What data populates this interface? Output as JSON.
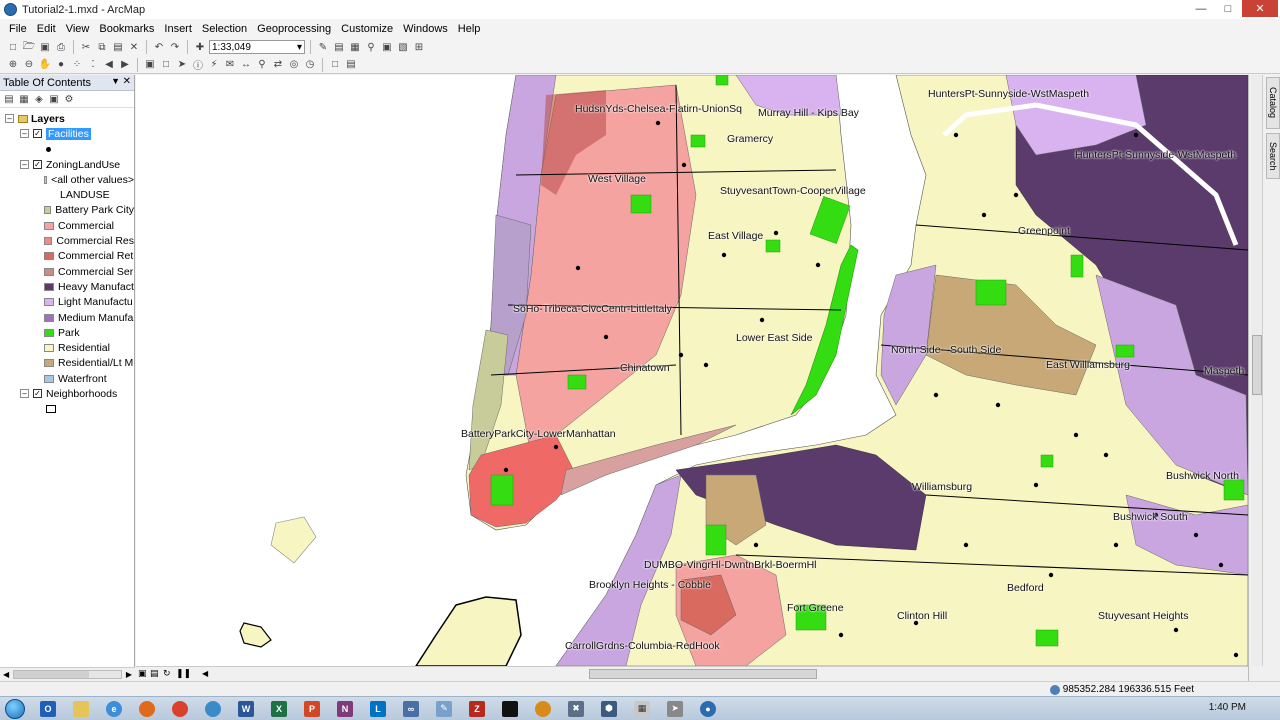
{
  "window": {
    "title": "Tutorial2-1.mxd - ArcMap"
  },
  "menu": [
    "File",
    "Edit",
    "View",
    "Bookmarks",
    "Insert",
    "Selection",
    "Geoprocessing",
    "Customize",
    "Windows",
    "Help"
  ],
  "toolbar": {
    "scale": "1:33,049"
  },
  "toc": {
    "title": "Table Of Contents",
    "root": "Layers",
    "facilities": "Facilities",
    "zoning": "ZoningLandUse",
    "all_other": "<all other values>",
    "landuse_header": "LANDUSE",
    "landuse_classes": [
      {
        "label": "Battery Park City",
        "color": "#c8cc9a"
      },
      {
        "label": "Commercial",
        "color": "#f4a3a0"
      },
      {
        "label": "Commercial Res",
        "color": "#f08b84"
      },
      {
        "label": "Commercial Ret",
        "color": "#d96a60"
      },
      {
        "label": "Commercial Ser",
        "color": "#c98c86"
      },
      {
        "label": "Heavy Manufact",
        "color": "#5a3b6b"
      },
      {
        "label": "Light Manufactu",
        "color": "#d9b3f0"
      },
      {
        "label": "Medium Manufa",
        "color": "#9e74b8"
      },
      {
        "label": "Park",
        "color": "#33dd11"
      },
      {
        "label": "Residential",
        "color": "#f7f5c1"
      },
      {
        "label": "Residential/Lt M",
        "color": "#c9a878"
      },
      {
        "label": "Waterfront",
        "color": "#a9c6e8"
      }
    ],
    "all_other_color": "#e6b3e6",
    "neighborhoods": "Neighborhoods"
  },
  "map": {
    "labels": [
      {
        "id": "hudson",
        "text": "HudsnYds-Chelsea-Flatirn-UnionSq"
      },
      {
        "id": "murray",
        "text": "Murray Hill - Kips Bay"
      },
      {
        "id": "gramercy",
        "text": "Gramercy"
      },
      {
        "id": "westvillage",
        "text": "West Village"
      },
      {
        "id": "stuy",
        "text": "StuyvesantTown-CooperVillage"
      },
      {
        "id": "eastvillage",
        "text": "East Village"
      },
      {
        "id": "soho",
        "text": "SoHo-Tribeca-CivcCentr-LittleItaly"
      },
      {
        "id": "les",
        "text": "Lower East Side"
      },
      {
        "id": "chinatown",
        "text": "Chinatown"
      },
      {
        "id": "bpc",
        "text": "BatteryParkCity-LowerManhattan"
      },
      {
        "id": "huntersTop",
        "text": "HuntersPt-Sunnyside-WstMaspeth"
      },
      {
        "id": "huntersMid",
        "text": "HuntersPt-Sunnyside-WstMaspeth"
      },
      {
        "id": "greenpoint",
        "text": "Greenpoint"
      },
      {
        "id": "northside",
        "text": "North Side - South Side"
      },
      {
        "id": "eastwburg",
        "text": "East Williamsburg"
      },
      {
        "id": "maspeth",
        "text": "Maspeth"
      },
      {
        "id": "williamsburg",
        "text": "Williamsburg"
      },
      {
        "id": "bushwickN",
        "text": "Bushwick North"
      },
      {
        "id": "bushwickS",
        "text": "Bushwick South"
      },
      {
        "id": "dumbo",
        "text": "DUMBO-VingrHl-DwntnBrkl-BoermHl"
      },
      {
        "id": "bkheights",
        "text": "Brooklyn Heights - Cobble"
      },
      {
        "id": "fortgreene",
        "text": "Fort Greene"
      },
      {
        "id": "clinton",
        "text": "Clinton Hill"
      },
      {
        "id": "bedford",
        "text": "Bedford"
      },
      {
        "id": "stuyheights",
        "text": "Stuyvesant Heights"
      },
      {
        "id": "carroll",
        "text": "CarrollGrdns-Columbia-RedHook"
      }
    ]
  },
  "right_dock": {
    "catalog": "Catalog",
    "search": "Search"
  },
  "status": {
    "coords": "985352.284  196336.515 Feet"
  },
  "taskbar": {
    "time": "1:40 PM"
  }
}
